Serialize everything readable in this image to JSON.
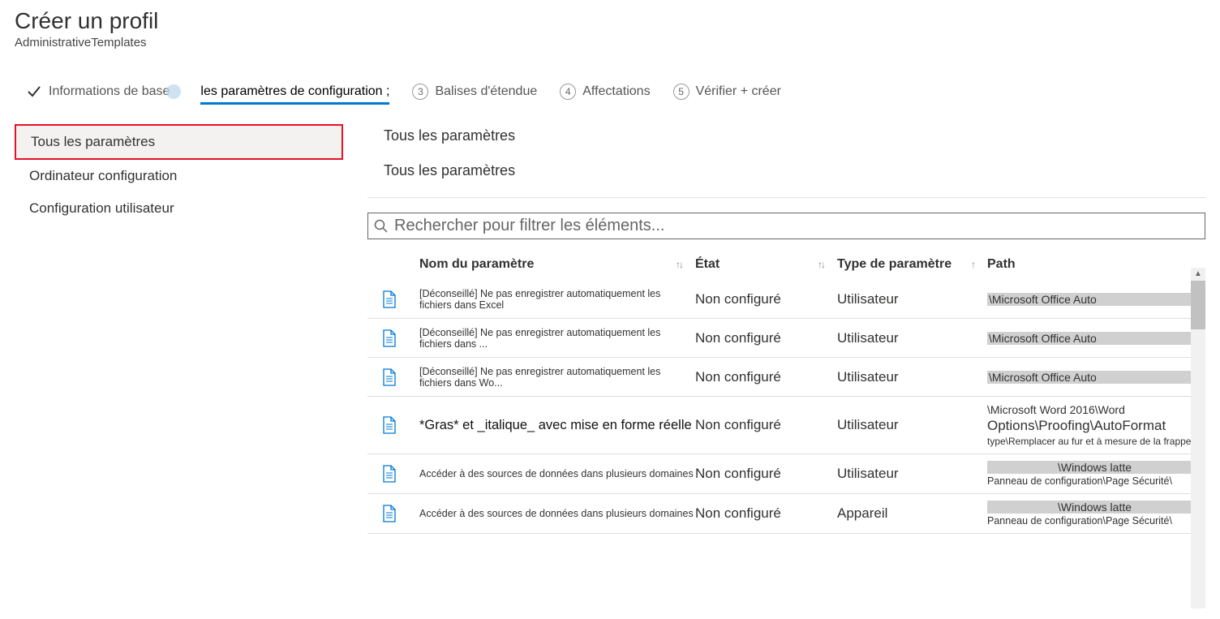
{
  "header": {
    "title": "Créer un profil",
    "subtitle": "AdministrativeTemplates"
  },
  "stepper": {
    "step1": "Informations de base",
    "step2": "les paramètres de configuration ;",
    "step3": "Balises d'étendue",
    "step4": "Affectations",
    "step5": "Vérifier + créer",
    "n3": "3",
    "n4": "4",
    "n5": "5"
  },
  "sidebar": {
    "items": [
      "Tous les paramètres",
      "Ordinateur configuration",
      "Configuration utilisateur"
    ]
  },
  "main": {
    "heading": "Tous les paramètres",
    "subheading": "Tous les paramètres",
    "search_placeholder": "Rechercher pour filtrer les éléments...",
    "columns": {
      "name": "Nom du paramètre",
      "state": "État",
      "type": "Type de paramètre",
      "path": "Path"
    },
    "rows": [
      {
        "name": "[Déconseillé] Ne pas enregistrer automatiquement les fichiers dans     Excel",
        "state": "Non configuré",
        "type": "Utilisateur",
        "path_hl": "\\Microsoft Office Auto",
        "path_lines": []
      },
      {
        "name": "[Déconseillé] Ne pas enregistrer automatiquement les fichiers dans ...",
        "state": "Non configuré",
        "type": "Utilisateur",
        "path_hl": "\\Microsoft Office Auto",
        "path_lines": []
      },
      {
        "name": "[Déconseillé] Ne pas enregistrer automatiquement les fichiers dans Wo...",
        "state": "Non configuré",
        "type": "Utilisateur",
        "path_hl": "\\Microsoft Office Auto",
        "path_lines": []
      },
      {
        "name": "*Gras* et _italique_ avec mise en forme réelle",
        "state": "Non configuré",
        "type": "Utilisateur",
        "path_hl": "",
        "path_lines": [
          "\\Microsoft Word 2016\\Word",
          "Options\\Proofing\\AutoFormat",
          "type\\Remplacer au fur et à mesure de la frappe"
        ]
      },
      {
        "name": "Accéder à des sources de données dans plusieurs domaines",
        "state": "Non configuré",
        "type": "Utilisateur",
        "path_hl": "\\Windows latte",
        "path_lines": [
          "Panneau de configuration\\Page Sécurité\\"
        ]
      },
      {
        "name": "Accéder à des sources de données dans plusieurs domaines",
        "state": "Non configuré",
        "type": "Appareil",
        "path_hl": "\\Windows latte",
        "path_lines": [
          "Panneau de configuration\\Page Sécurité\\"
        ]
      }
    ]
  }
}
